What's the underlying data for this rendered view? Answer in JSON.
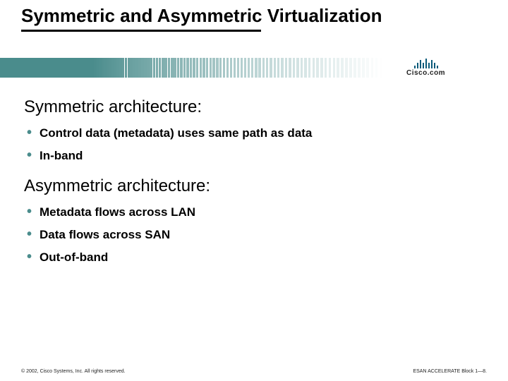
{
  "title": "Symmetric and Asymmetric Virtualization",
  "logo_text": "Cisco.com",
  "section1": {
    "heading": "Symmetric architecture:",
    "bullets": [
      "Control data (metadata) uses same path as data",
      "In-band"
    ]
  },
  "section2": {
    "heading": "Asymmetric architecture:",
    "bullets": [
      "Metadata flows across LAN",
      "Data flows across SAN",
      "Out-of-band"
    ]
  },
  "footer_left": "© 2002, Cisco Systems, Inc. All rights reserved.",
  "footer_right": "ESAN ACCELERATE Block 1—8."
}
